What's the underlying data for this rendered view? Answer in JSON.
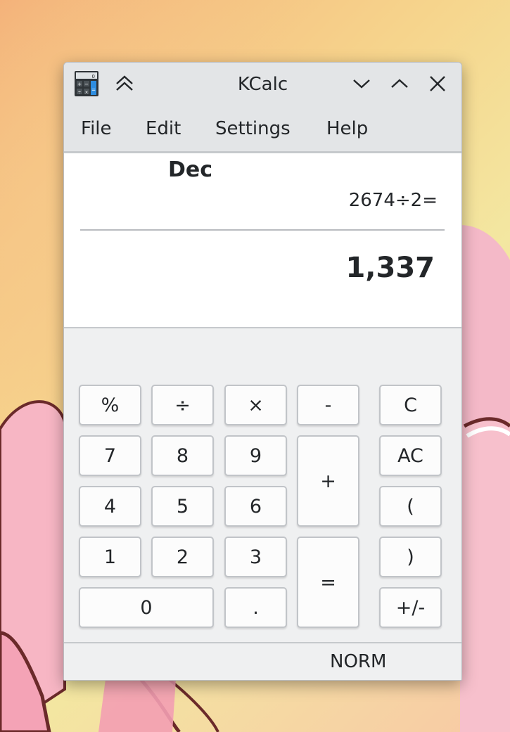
{
  "window": {
    "title": "KCalc"
  },
  "menu": {
    "file": "File",
    "edit": "Edit",
    "settings": "Settings",
    "help": "Help"
  },
  "display": {
    "base": "Dec",
    "history": "2674÷2=",
    "result": "1,337"
  },
  "keys": {
    "percent": "%",
    "divide": "÷",
    "multiply": "×",
    "minus": "-",
    "clear": "C",
    "seven": "7",
    "eight": "8",
    "nine": "9",
    "plus": "+",
    "all_clear": "AC",
    "four": "4",
    "five": "5",
    "six": "6",
    "open_paren": "(",
    "one": "1",
    "two": "2",
    "three": "3",
    "equals": "=",
    "close_paren": ")",
    "zero": "0",
    "decimal": ".",
    "sign": "+/-"
  },
  "status": {
    "mode": "NORM"
  },
  "icons": {
    "app": "calculator-icon",
    "keep_above": "double-chevron-up-icon",
    "minimize": "chevron-down-icon",
    "maximize": "chevron-up-icon",
    "close": "close-icon"
  },
  "colors": {
    "window_bg": "#eff0f1",
    "titlebar_bg": "#e3e5e7",
    "display_bg": "#ffffff",
    "text": "#232629",
    "key_bg": "#fcfcfc",
    "key_border": "#c1c4c8"
  }
}
